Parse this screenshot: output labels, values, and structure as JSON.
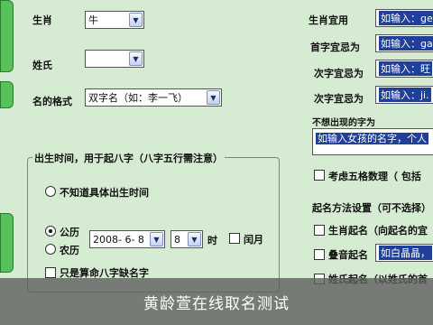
{
  "left": {
    "zodiac_label": "生肖",
    "zodiac_value": "牛",
    "surname_label": "姓氏",
    "surname_value": "",
    "name_format_label": "名的格式",
    "name_format_value": "双字名（如：李一飞）",
    "birth_group_legend": "出生时间，用于起八字（八字五行需注意）",
    "unknown_birth_label": "不知道具体出生时间",
    "solar_label": "公历",
    "lunar_label": "农历",
    "date_value": "2008- 6- 8",
    "hour_value": "8",
    "hour_unit": "时",
    "leap_month_label": "闰月",
    "bazi_surname_label": "只是算命八字缺名字"
  },
  "right": {
    "zodiac_label": "生肖宜用",
    "zodiac_input": "如输入：gen",
    "shengxiao_avoid_label": "首字宜忌为",
    "shengxiao_avoid_input": "如输入：gao",
    "second_char_label": "次字宜忌为",
    "second_char_input": "如输入：旺",
    "third_char_label": "次字宜忌为",
    "third_char_input": "如输入：ji.",
    "exclude_label": "不想出现的字为",
    "exclude_text": "如输入女孩的名字，个人",
    "five_elements_label": "考虑五格数理（ 包括",
    "method_label": "起名方法设置（可不选择）",
    "shengxiao_method_label": "生肖起名（向起名的宜",
    "rhythm_label": "叠音起名",
    "rhythm_input": "如白晶晶，",
    "surname_method_label": "姓氏起名（以姓氏的首"
  },
  "caption": "黄龄萱在线取名测试"
}
